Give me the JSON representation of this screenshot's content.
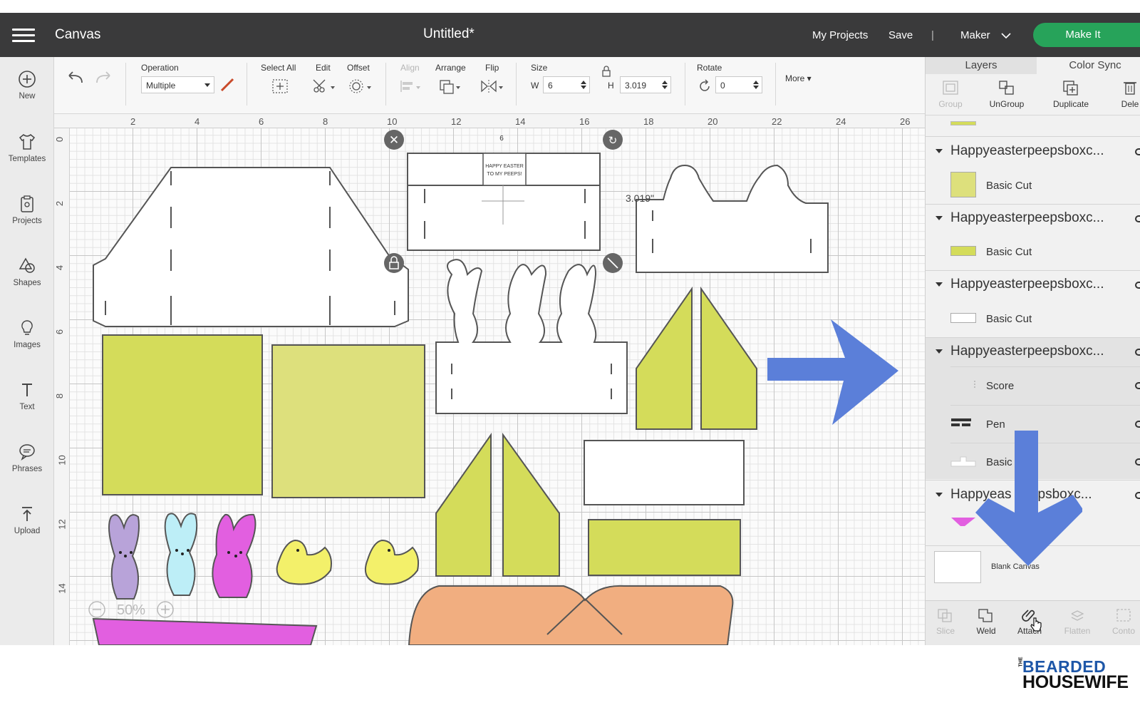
{
  "header": {
    "app_title": "Canvas",
    "doc_title": "Untitled*",
    "my_projects": "My Projects",
    "save": "Save",
    "separator": "|",
    "machine": "Maker",
    "make_it": "Make It",
    "make_it_color": "#27a35a"
  },
  "sidebar": {
    "items": [
      {
        "label": "New",
        "icon": "plus-circle-icon"
      },
      {
        "label": "Templates",
        "icon": "shirt-icon"
      },
      {
        "label": "Projects",
        "icon": "clipboard-icon"
      },
      {
        "label": "Shapes",
        "icon": "shapes-icon"
      },
      {
        "label": "Images",
        "icon": "lightbulb-icon"
      },
      {
        "label": "Text",
        "icon": "text-icon"
      },
      {
        "label": "Phrases",
        "icon": "speech-bubble-icon"
      },
      {
        "label": "Upload",
        "icon": "upload-icon"
      }
    ]
  },
  "toolbar": {
    "operation_label": "Operation",
    "operation_value": "Multiple",
    "select_all": "Select All",
    "edit": "Edit",
    "offset": "Offset",
    "align": "Align",
    "arrange": "Arrange",
    "flip": "Flip",
    "size": "Size",
    "w_label": "W",
    "w_value": "6",
    "h_label": "H",
    "h_value": "3.019",
    "rotate": "Rotate",
    "rotate_value": "0",
    "more": "More"
  },
  "canvas": {
    "ruler_top": [
      "2",
      "4",
      "6",
      "8",
      "10",
      "12",
      "14",
      "16",
      "18",
      "20",
      "22",
      "24",
      "26"
    ],
    "ruler_left": [
      "0",
      "2",
      "4",
      "6",
      "8",
      "10",
      "12",
      "14"
    ],
    "zoom": "50%",
    "dimension_label": "3.019\"",
    "dimension_top": "6",
    "label_text": "HAPPY EASTER TO MY PEEPS!",
    "colors": {
      "green": "#d4dc5a",
      "light_green": "#dde07c",
      "lavender": "#b8a3d9",
      "light_blue": "#bdeef7",
      "magenta": "#e25fe0",
      "yellow": "#f3f06a",
      "orange": "#f1ae80",
      "arrow_blue": "#5b7fd9"
    }
  },
  "panel": {
    "tabs": [
      "Layers",
      "Color Sync"
    ],
    "actions": [
      "Group",
      "UnGroup",
      "Duplicate",
      "Dele"
    ],
    "groups": [
      {
        "name": "Happyeasterpeepsboxc...",
        "layer": "Basic Cut",
        "swatch": "#dde07c"
      },
      {
        "name": "Happyeasterpeepsboxc...",
        "layer": "Basic Cut",
        "swatch": "#d4dc5a"
      },
      {
        "name": "Happyeasterpeepsboxc...",
        "layer": "Basic Cut",
        "swatch": "#ffffff"
      },
      {
        "name": "Happyeasterpeepsboxc...",
        "layers": [
          "Score",
          "Pen",
          "Basic"
        ]
      },
      {
        "name": "Happyeas peepsboxc...",
        "swatch": "#e25fe0"
      }
    ],
    "blank_canvas": "Blank Canvas",
    "bottom_actions": [
      "Slice",
      "Weld",
      "Attach",
      "Flatten",
      "Conto"
    ]
  },
  "watermark": {
    "line1": "BEARDED",
    "line2": "HOUSEWIFE",
    "the": "THE"
  }
}
